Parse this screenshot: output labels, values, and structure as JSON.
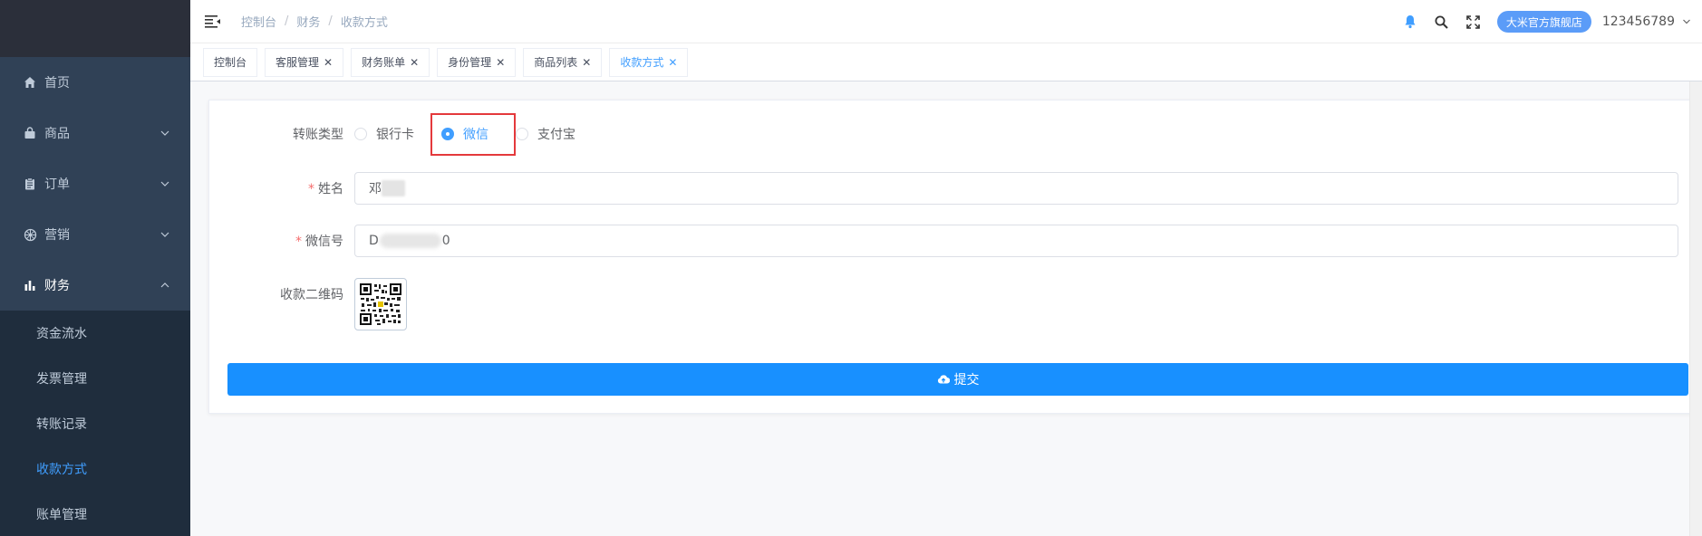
{
  "breadcrumb": [
    "控制台",
    "财务",
    "收款方式"
  ],
  "header": {
    "shop_name": "大米官方旗舰店",
    "username": "123456789"
  },
  "sidebar": {
    "items": [
      {
        "label": "首页",
        "icon": "home-icon"
      },
      {
        "label": "商品",
        "icon": "bag-icon"
      },
      {
        "label": "订单",
        "icon": "clipboard-icon"
      },
      {
        "label": "营销",
        "icon": "wheel-icon"
      },
      {
        "label": "财务",
        "icon": "bar-chart-icon"
      }
    ],
    "finance_sub": [
      "资金流水",
      "发票管理",
      "转账记录",
      "收款方式",
      "账单管理"
    ]
  },
  "tags": [
    "控制台",
    "客服管理",
    "财务账单",
    "身份管理",
    "商品列表",
    "收款方式"
  ],
  "form": {
    "transfer_type_label": "转账类型",
    "options": [
      "银行卡",
      "微信",
      "支付宝"
    ],
    "selected": "微信",
    "name_label": "姓名",
    "name_value": "邓",
    "wechat_label": "微信号",
    "wechat_prefix": "D",
    "wechat_suffix": "0",
    "qr_label": "收款二维码",
    "required_mark": "*",
    "submit_label": "提交"
  },
  "colors": {
    "sidebar_bg": "#304156",
    "primary": "#409eff",
    "submit": "#1890ff",
    "highlight": "#e4393c"
  }
}
